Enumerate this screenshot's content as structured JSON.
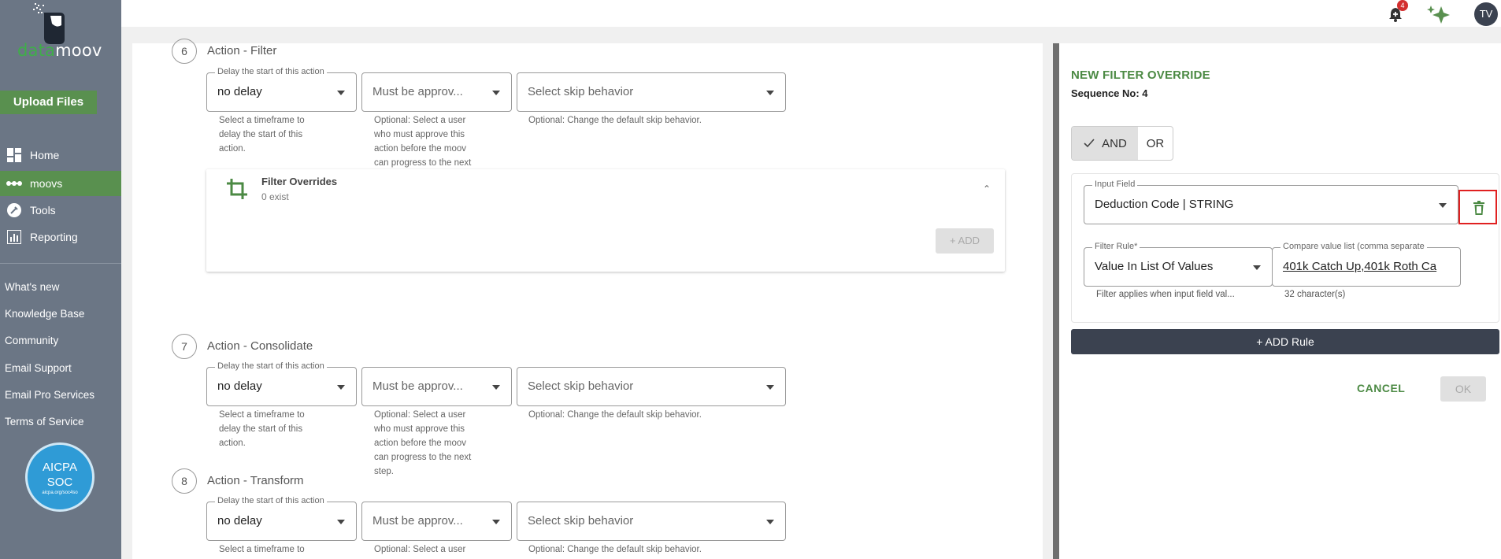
{
  "sidebar": {
    "logo_part1": "data",
    "logo_part2": "moov",
    "upload_label": "Upload Files",
    "nav": [
      {
        "label": "Home",
        "icon": "dashboard-icon"
      },
      {
        "label": "moovs",
        "icon": "workflow-dots-icon",
        "active": true
      },
      {
        "label": "Tools",
        "icon": "wrench-icon"
      },
      {
        "label": "Reporting",
        "icon": "bar-chart-icon"
      }
    ],
    "links": [
      "What's new",
      "Knowledge Base",
      "Community",
      "Email Support",
      "Email Pro Services",
      "Terms of Service"
    ],
    "badge": {
      "line1": "AICPA",
      "line2": "SOC",
      "line3": "aicpa.org/soc4so"
    }
  },
  "topbar": {
    "notification_count": "4",
    "avatar_initials": "TV"
  },
  "steps": [
    {
      "number": "6",
      "title": "Action - Filter",
      "delay_label": "Delay the start of this action",
      "delay_value": "no delay",
      "approver_placeholder": "Must be approv...",
      "skip_placeholder": "Select skip behavior",
      "delay_help": [
        "Select a timeframe to",
        "delay the start of this",
        "action."
      ],
      "approver_help": [
        "Optional: Select a user",
        "who must approve this",
        "action before the moov",
        "can progress to the next"
      ],
      "skip_help": "Optional: Change the default skip behavior.",
      "filter_overrides": {
        "title": "Filter Overrides",
        "count": "0 exist",
        "add_label": "+ ADD"
      }
    },
    {
      "number": "7",
      "title": "Action - Consolidate",
      "delay_label": "Delay the start of this action",
      "delay_value": "no delay",
      "approver_placeholder": "Must be approv...",
      "skip_placeholder": "Select skip behavior",
      "delay_help": [
        "Select a timeframe to",
        "delay the start of this",
        "action."
      ],
      "approver_help": [
        "Optional: Select a user",
        "who must approve this",
        "action before the moov",
        "can progress to the next",
        "step."
      ],
      "skip_help": "Optional: Change the default skip behavior."
    },
    {
      "number": "8",
      "title": "Action - Transform",
      "delay_label": "Delay the start of this action",
      "delay_value": "no delay",
      "approver_placeholder": "Must be approv...",
      "skip_placeholder": "Select skip behavior",
      "delay_help": [
        "Select a timeframe to"
      ],
      "approver_help": [
        "Optional: Select a user"
      ],
      "skip_help": "Optional: Change the default skip behavior."
    }
  ],
  "panel": {
    "title": "NEW FILTER OVERRIDE",
    "sequence": "Sequence No: 4",
    "and_label": "AND",
    "or_label": "OR",
    "input_field_label": "Input Field",
    "input_field_value": "Deduction Code | STRING",
    "filter_rule_label": "Filter Rule*",
    "filter_rule_value": "Value In List Of Values",
    "filter_rule_help": "Filter applies when input field val...",
    "compare_label": "Compare value list (comma separate",
    "compare_value": "401k Catch Up,401k Roth Ca",
    "compare_count": "32 character(s)",
    "add_rule_label": "+ ADD Rule",
    "cancel_label": "CANCEL",
    "ok_label": "OK"
  }
}
